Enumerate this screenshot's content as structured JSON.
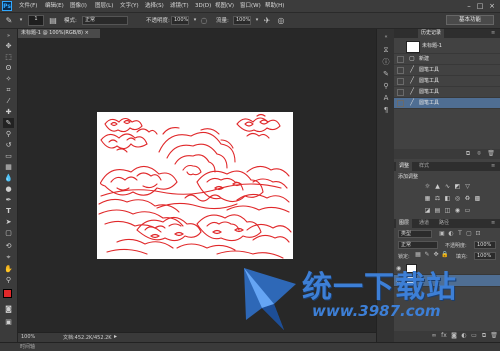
{
  "app": {
    "logo": "Ps"
  },
  "menu": [
    "文件(F)",
    "编辑(E)",
    "图像(I)",
    "图层(L)",
    "文字(Y)",
    "选择(S)",
    "滤镜(T)",
    "3D(D)",
    "视图(V)",
    "窗口(W)",
    "帮助(H)"
  ],
  "window_controls": {
    "minimize": "–",
    "maximize": "□",
    "close": "×"
  },
  "options": {
    "brush_size": "1",
    "mode_label": "模式:",
    "mode_value": "正常",
    "opacity_label": "不透明度:",
    "opacity_value": "100%",
    "flow_label": "流量:",
    "flow_value": "100%",
    "workspace": "基本功能"
  },
  "document": {
    "tab_title": "未标题-1 @ 100%(RGB/8) ×",
    "zoom": "100%",
    "doc_info": "文档:452.2K/452.2K"
  },
  "history_panel": {
    "tabs": [
      "历史记录"
    ],
    "snapshot": "未标题-1",
    "items": [
      "新建",
      "圆笔工具",
      "圆笔工具",
      "圆笔工具",
      "圆笔工具"
    ],
    "selected_index": 4
  },
  "adjust_panel": {
    "tabs": [
      "调整",
      "样式"
    ],
    "title": "添加调整"
  },
  "layers_panel": {
    "tabs": [
      "图层",
      "通道",
      "路径"
    ],
    "kind": "类型",
    "blend_mode": "正常",
    "opacity_label": "不透明度:",
    "opacity_value": "100%",
    "lock_label": "锁定:",
    "fill_label": "填充:",
    "fill_value": "100%"
  },
  "bottom": {
    "label": "时间轴"
  },
  "watermark": {
    "text": "统一下载站",
    "url": "www.3987.com"
  },
  "colors": {
    "accent": "#31a8ff",
    "selection": "#4f6e93",
    "ink": "#e0282a",
    "watermark": "#3d7fd6"
  }
}
